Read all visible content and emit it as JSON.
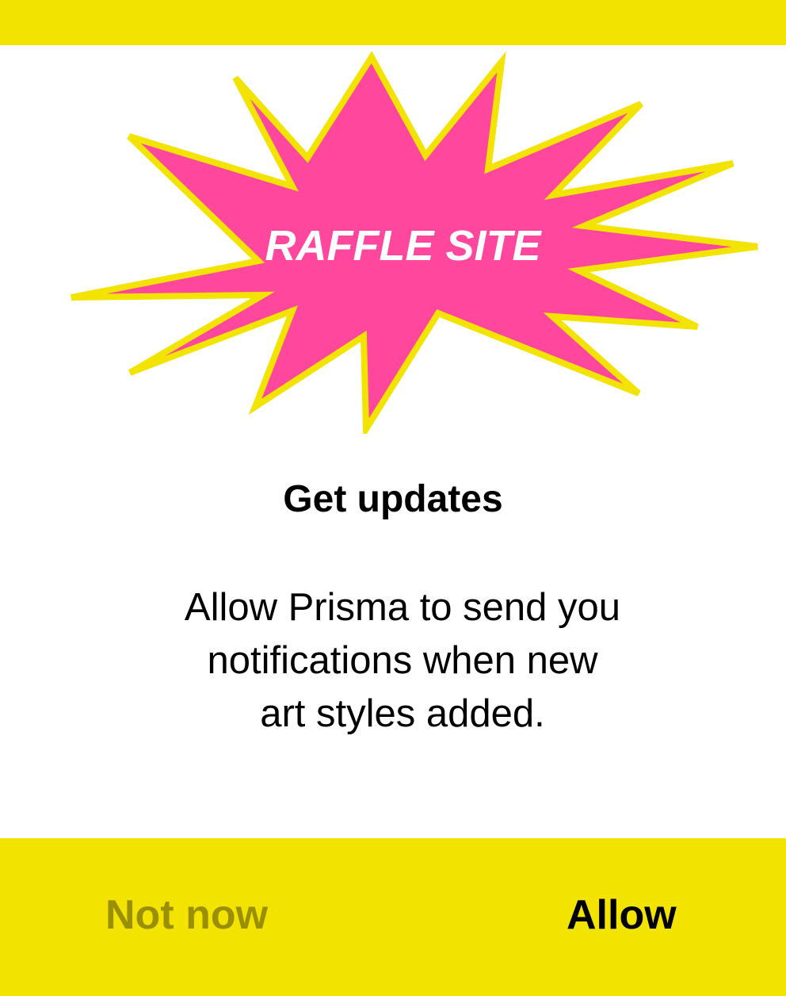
{
  "colors": {
    "accent": "#f3e300",
    "burst_fill": "#ff479d",
    "burst_stroke": "#f3e300",
    "not_now_text": "#9a8f00",
    "allow_text": "#000000"
  },
  "banner": {
    "label": "RAFFLE SITE",
    "icon": "starburst-icon"
  },
  "dialog": {
    "title": "Get updates",
    "message_lines": [
      "Allow Prisma to send you",
      "notifications when new",
      "art styles added."
    ]
  },
  "actions": {
    "not_now_label": "Not now",
    "allow_label": "Allow"
  }
}
